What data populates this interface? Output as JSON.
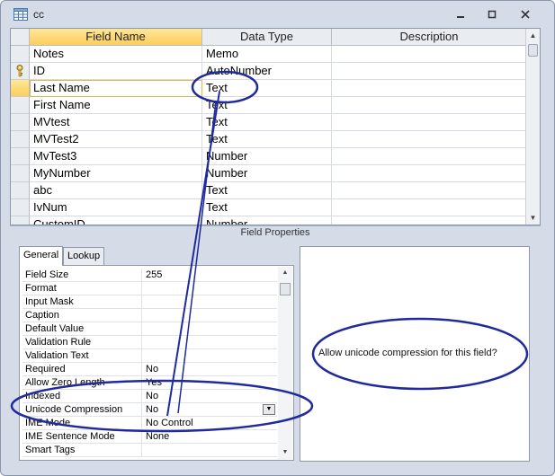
{
  "window": {
    "title": "cc"
  },
  "grid": {
    "headers": {
      "field_name": "Field Name",
      "data_type": "Data Type",
      "description": "Description"
    },
    "rows": [
      {
        "name": "Notes",
        "type": "Memo",
        "desc": ""
      },
      {
        "name": "ID",
        "type": "AutoNumber",
        "desc": "",
        "primary_key": true
      },
      {
        "name": "Last Name",
        "type": "Text",
        "desc": "",
        "selected": true
      },
      {
        "name": "First Name",
        "type": "Text",
        "desc": ""
      },
      {
        "name": "MVtest",
        "type": "Text",
        "desc": ""
      },
      {
        "name": "MVTest2",
        "type": "Text",
        "desc": ""
      },
      {
        "name": "MvTest3",
        "type": "Number",
        "desc": ""
      },
      {
        "name": "MyNumber",
        "type": "Number",
        "desc": ""
      },
      {
        "name": "abc",
        "type": "Text",
        "desc": ""
      },
      {
        "name": "IvNum",
        "type": "Text",
        "desc": ""
      },
      {
        "name": "CustomID",
        "type": "Number",
        "desc": ""
      }
    ]
  },
  "field_properties": {
    "title": "Field Properties",
    "tabs": {
      "general": "General",
      "lookup": "Lookup"
    },
    "rows": [
      {
        "label": "Field Size",
        "value": "255"
      },
      {
        "label": "Format",
        "value": ""
      },
      {
        "label": "Input Mask",
        "value": ""
      },
      {
        "label": "Caption",
        "value": ""
      },
      {
        "label": "Default Value",
        "value": ""
      },
      {
        "label": "Validation Rule",
        "value": ""
      },
      {
        "label": "Validation Text",
        "value": ""
      },
      {
        "label": "Required",
        "value": "No"
      },
      {
        "label": "Allow Zero Length",
        "value": "Yes"
      },
      {
        "label": "Indexed",
        "value": "No"
      },
      {
        "label": "Unicode Compression",
        "value": "No",
        "dropdown": true
      },
      {
        "label": "IME Mode",
        "value": "No Control"
      },
      {
        "label": "IME Sentence Mode",
        "value": "None"
      },
      {
        "label": "Smart Tags",
        "value": ""
      }
    ],
    "help_text": "Allow unicode compression for this field?"
  },
  "colors": {
    "annotation": "#1f2a9c",
    "selected_header": "#fbcf5b"
  },
  "icons": [
    "table-icon",
    "minimize-icon",
    "maximize-icon",
    "close-icon",
    "primary-key-icon",
    "dropdown-arrow-icon"
  ]
}
